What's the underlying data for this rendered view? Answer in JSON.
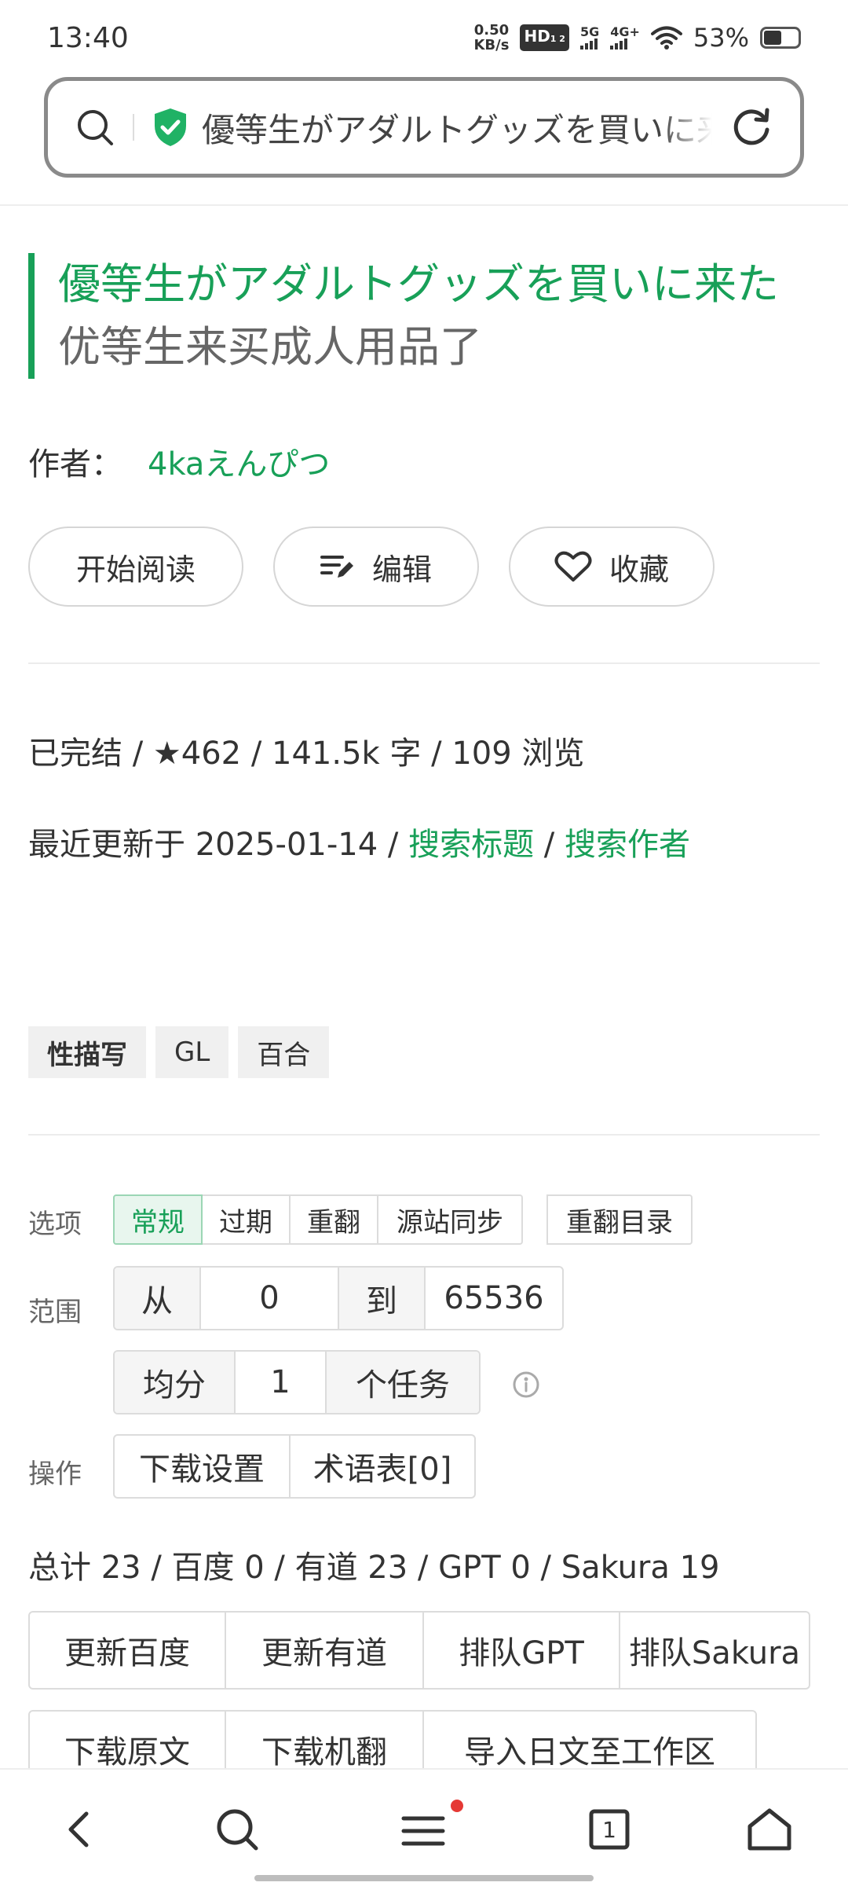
{
  "status_bar": {
    "time": "13:40",
    "net_speed_value": "0.50",
    "net_speed_unit": "KB/s",
    "hd_label": "HD",
    "hd_sub": "1 2",
    "sig1_label": "5G",
    "sig2_label": "4G+",
    "battery_percent": "53%",
    "battery_level": 0.53
  },
  "address_bar": {
    "text": "優等生がアダルトグッズを買いに来た"
  },
  "novel": {
    "title_jp": "優等生がアダルトグッズを買いに来た",
    "title_zh": "优等生来买成人用品了",
    "author_label": "作者：",
    "author_name": "4kaえんぴつ"
  },
  "actions": {
    "start_reading": "开始阅读",
    "edit": "编辑",
    "favorite": "收藏"
  },
  "meta": {
    "line1": "已完结 / ★462 / 141.5k 字 / 109 浏览",
    "updated_prefix": "最近更新于 2025-01-14 / ",
    "search_title": "搜索标题",
    "slash": " / ",
    "search_author": "搜索作者"
  },
  "tags": [
    "性描写",
    "GL",
    "百合"
  ],
  "options": {
    "label": "选项",
    "items": [
      "常规",
      "过期",
      "重翻",
      "源站同步"
    ],
    "retranslate_toc": "重翻目录"
  },
  "range": {
    "label": "范围",
    "from_label": "从",
    "from_value": "0",
    "to_label": "到",
    "to_value": "65536",
    "split_label": "均分",
    "split_value": "1",
    "task_label": "个任务"
  },
  "operation": {
    "label": "操作",
    "download_settings": "下载设置",
    "glossary": "术语表[0]"
  },
  "stats": {
    "text": "总计 23 / 百度 0 / 有道 23 / GPT 0 / Sakura 19"
  },
  "jobs_row1": [
    "更新百度",
    "更新有道",
    "排队GPT",
    "排队Sakura"
  ],
  "jobs_row2": [
    "下载原文",
    "下载机翻",
    "导入日文至工作区"
  ],
  "colors": {
    "accent": "#18a058",
    "notification_dot": "#e53935"
  },
  "bottom_nav": {
    "tab_count": "1"
  }
}
